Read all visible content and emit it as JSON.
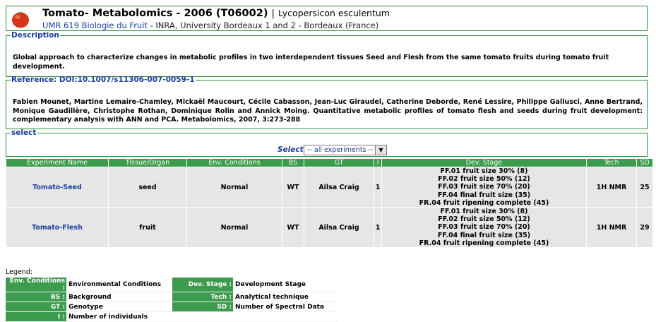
{
  "header": {
    "title": "Tomato- Metabolomics - 2006 (T06002)",
    "separator": "|",
    "species": "Lycopersicon esculentum",
    "lab": "UMR 619 Biologie du Fruit",
    "affiliation": " - INRA, University Bordeaux 1 and 2 - Bordeaux (France)"
  },
  "description": {
    "legend": "Description",
    "text": "Global approach to characterize changes in metabolic profiles in two interdependent tissues Seed and Flesh from the same tomato fruits during tomato fruit development."
  },
  "reference": {
    "legend": "Reference: DOI:10.1007/s11306-007-0059-1",
    "text": "Fabien Mounet, Martine Lemaire-Chamley, Mickaël Maucourt, Cécile Cabasson, Jean-Luc Giraudel, Catherine Deborde, René Lessire, Philippe Gallusci, Anne Bertrand, Monique Gaudillère, Christophe Rothan, Dominique Rolin and Annick Moing. Quantitative metabolic profiles of tomato flesh and seeds during fruit development: complementary analysis with ANN and PCA. Metabolomics, 2007, 3:273-288"
  },
  "select": {
    "legend": "select",
    "label": "Select:",
    "value": "-- all experiments --"
  },
  "table": {
    "headers": [
      "Experiment Name",
      "Tissue/Organ",
      "Env. Conditions",
      "BS",
      "GT",
      "I",
      "Dev. Stage",
      "Tech",
      "SD"
    ],
    "rows": [
      {
        "name": "Tomato-Seed",
        "tissue": "seed",
        "env": "Normal",
        "bs": "WT",
        "gt": "Ailsa Craig",
        "i": "1",
        "stages": [
          "FF.01 fruit size 30% (8)",
          "FF.02 fruit size 50% (12)",
          "FF.03 fruit size 70% (20)",
          "FF.04 final fruit size (35)",
          "FR.04 fruit ripening complete (45)"
        ],
        "tech": "1H NMR",
        "sd": "25"
      },
      {
        "name": "Tomato-Flesh",
        "tissue": "fruit",
        "env": "Normal",
        "bs": "WT",
        "gt": "Ailsa Craig",
        "i": "1",
        "stages": [
          "FF.01 fruit size 30% (8)",
          "FF.02 fruit size 50% (12)",
          "FF.03 fruit size 70% (20)",
          "FF.04 final fruit size (35)",
          "FR.04 fruit ripening complete (45)"
        ],
        "tech": "1H NMR",
        "sd": "29"
      }
    ]
  },
  "legend": {
    "title": "Legend:",
    "rows": [
      {
        "k1": "Env. Conditions :",
        "v1": "Environmental Conditions",
        "k2": "Dev. Stage :",
        "v2": "Development Stage"
      },
      {
        "k1": "BS :",
        "v1": "Background",
        "k2": "Tech :",
        "v2": "Analytical technique"
      },
      {
        "k1": "GT :",
        "v1": "Genotype",
        "k2": "SD :",
        "v2": "Number of Spectral Data"
      },
      {
        "k1": "I :",
        "v1": "Number of individuals",
        "k2": "",
        "v2": ""
      }
    ]
  },
  "colors": {
    "header_green": "#3c9b4c",
    "border_green": "#2e8b3e",
    "link_blue": "#1d3f9a",
    "row_gray": "#e6e6e6"
  },
  "icons": {
    "logo": "tomato-icon",
    "dropdown": "chevron-down-icon"
  }
}
